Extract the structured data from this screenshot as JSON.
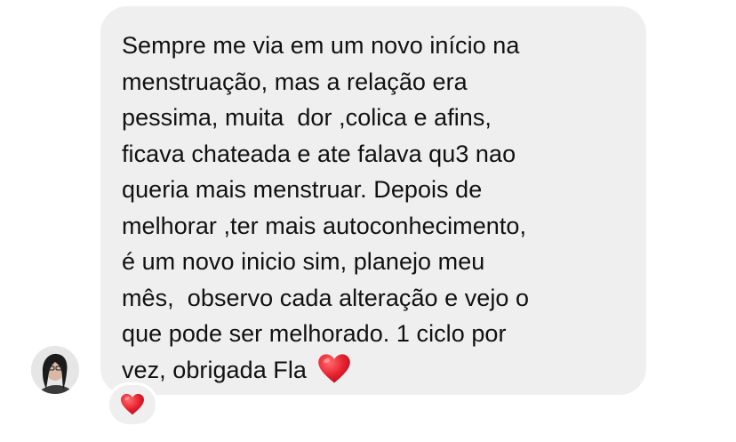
{
  "message": {
    "lines": [
      "Sempre me via em um novo início na",
      "menstruação, mas a relação era",
      "pessima, muita  dor ,colica e afins,",
      "ficava chateada e ate falava qu3 nao",
      "queria mais menstruar. Depois de",
      "melhorar ,ter mais autoconhecimento,",
      "é um novo inicio sim, planejo meu",
      "mês,  observo cada alteração e vejo o",
      "que pode ser melhorado. 1 ciclo por",
      "vez, obrigada Fla "
    ],
    "end_emoji": "red-heart-icon"
  },
  "reaction": {
    "emoji": "red-heart-icon"
  },
  "colors": {
    "bubble_background": "#efefef",
    "text": "#111111",
    "heart": "#e8202f"
  }
}
